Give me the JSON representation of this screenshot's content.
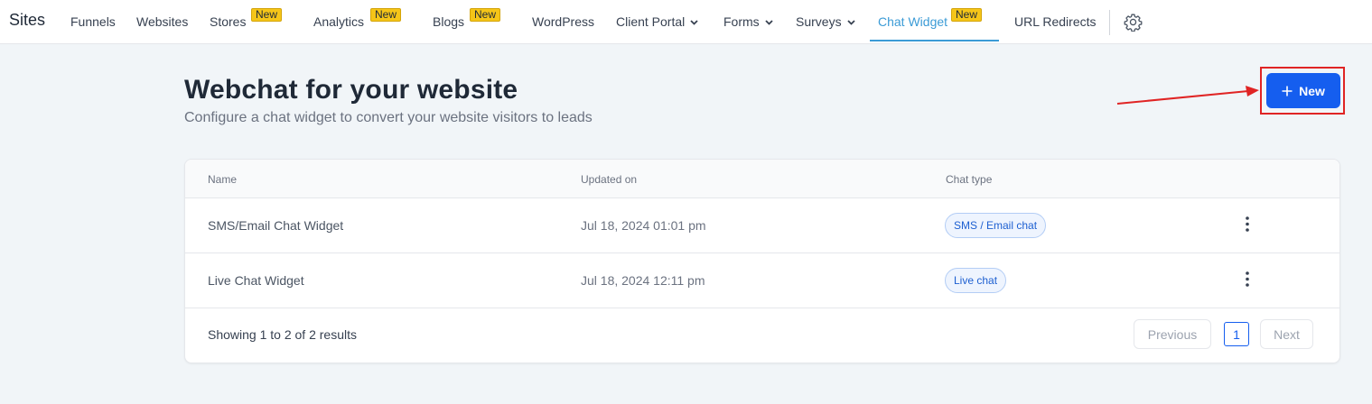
{
  "nav": {
    "brand": "Sites",
    "items": [
      {
        "label": "Funnels"
      },
      {
        "label": "Websites"
      },
      {
        "label": "Stores",
        "badge": "New"
      },
      {
        "label": "Analytics",
        "badge": "New"
      },
      {
        "label": "Blogs",
        "badge": "New"
      },
      {
        "label": "WordPress"
      },
      {
        "label": "Client Portal",
        "icon": "chevron-down-icon"
      },
      {
        "label": "Forms",
        "icon": "chevron-down-icon"
      },
      {
        "label": "Surveys",
        "icon": "chevron-down-icon"
      },
      {
        "label": "Chat Widget",
        "badge": "New",
        "active": true
      },
      {
        "label": "URL Redirects"
      }
    ],
    "settings_icon": "gear-icon"
  },
  "header": {
    "title": "Webchat for your website",
    "subtitle": "Configure a chat widget to convert your website visitors to leads",
    "new_button": {
      "label": "New",
      "icon": "plus-icon"
    }
  },
  "table": {
    "columns": [
      "Name",
      "Updated on",
      "Chat type"
    ],
    "rows": [
      {
        "name": "SMS/Email Chat Widget",
        "updated": "Jul 18, 2024 01:01 pm",
        "type": "SMS / Email chat"
      },
      {
        "name": "Live Chat Widget",
        "updated": "Jul 18, 2024 12:11 pm",
        "type": "Live chat"
      }
    ],
    "summary": "Showing 1 to 2 of 2 results",
    "pagination": {
      "previous": "Previous",
      "current": "1",
      "next": "Next"
    }
  },
  "colors": {
    "accent": "#155eef",
    "active_tab": "#3b9bd6",
    "badge": "#f5c518",
    "annotation": "#e02424"
  }
}
